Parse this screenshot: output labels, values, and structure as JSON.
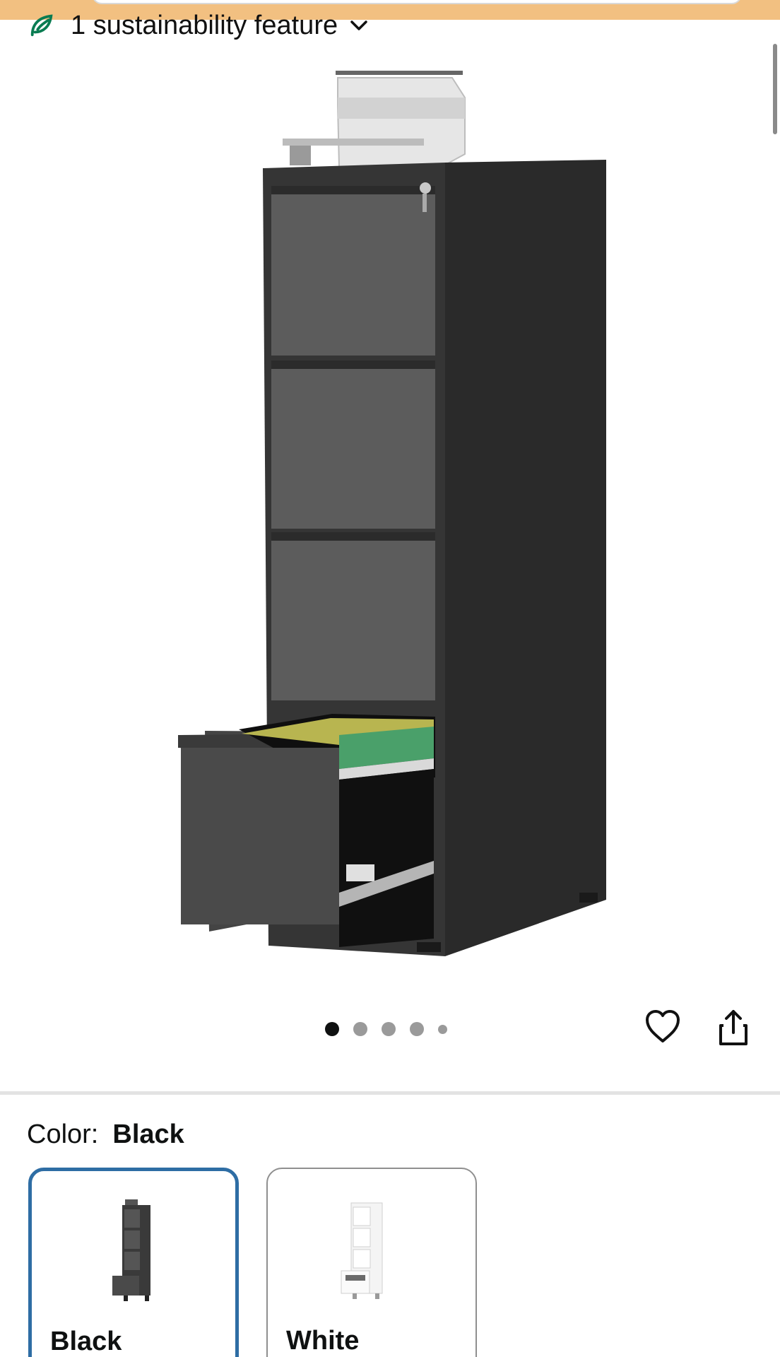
{
  "sustainability": {
    "label": "1 sustainability feature"
  },
  "carousel": {
    "image_count": 5,
    "active_index": 0
  },
  "color_selector": {
    "label": "Color:",
    "selected": "Black",
    "options": [
      {
        "name": "Black",
        "selected": true
      },
      {
        "name": "White",
        "selected": false
      }
    ]
  },
  "colors": {
    "banner": "#f2c081",
    "selected_border": "#2e6da4",
    "leaf": "#0a7c52"
  }
}
